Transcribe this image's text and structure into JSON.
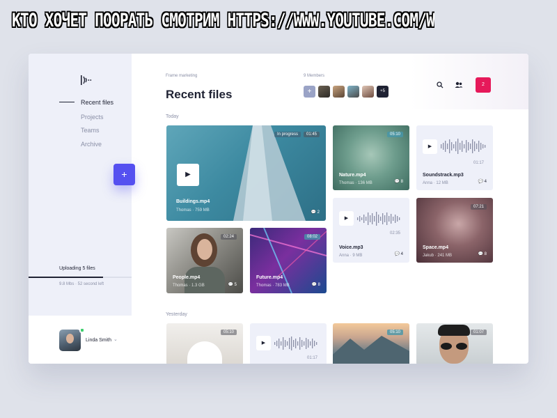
{
  "caption": "КТО ХОЧЕТ ПООРАТЬ СМОТРИМ HTTPS://WWW.YOUTUBE.COM/WATCH?V=UEA",
  "sidebar": {
    "nav": [
      "Recent files",
      "Projects",
      "Teams",
      "Archive"
    ],
    "upload": {
      "label": "Uploading 5 files",
      "meta": "9.8 Mbs · 52 second left",
      "progress": 0.72
    },
    "user": {
      "name": "Linda Smith"
    },
    "fab_label": "+"
  },
  "header": {
    "eyebrow": "Frame marketing",
    "title": "Recent files",
    "members_label": "9 Members",
    "members_more": "+5",
    "add_member": "+",
    "notifications": "2"
  },
  "sections": {
    "today": "Today",
    "yesterday": "Yesterday"
  },
  "files": [
    {
      "name": "Buildings.mp4",
      "owner": "Thomas",
      "size": "759 MB",
      "duration": "01:45",
      "comments": "2",
      "status": "In progress"
    },
    {
      "name": "Nature.mp4",
      "owner": "Thomas",
      "size": "136 MB",
      "duration": "05:10",
      "comments": "8"
    },
    {
      "name": "Soundstrack.mp3",
      "owner": "Anna",
      "size": "12 MB",
      "duration": "01:17",
      "comments": "4"
    },
    {
      "name": "Voice.mp3",
      "owner": "Anna",
      "size": "9 MB",
      "duration": "02:35",
      "comments": "4"
    },
    {
      "name": "Space.mp4",
      "owner": "Jakub",
      "size": "241 MB",
      "duration": "07:21",
      "comments": "8"
    },
    {
      "name": "People.mp4",
      "owner": "Thomas",
      "size": "1.3 GB",
      "duration": "02:24",
      "comments": "5"
    },
    {
      "name": "Future.mp4",
      "owner": "Thomas",
      "size": "783 MB",
      "duration": "08:02",
      "comments": "8"
    }
  ],
  "yesterday": [
    {
      "duration": "05:10"
    },
    {
      "duration": "01:17"
    },
    {
      "duration": "05:10"
    },
    {
      "duration": "01:07"
    }
  ],
  "colors": {
    "accent": "#5550f0",
    "notification": "#e6195a",
    "online": "#3ecf6e"
  }
}
